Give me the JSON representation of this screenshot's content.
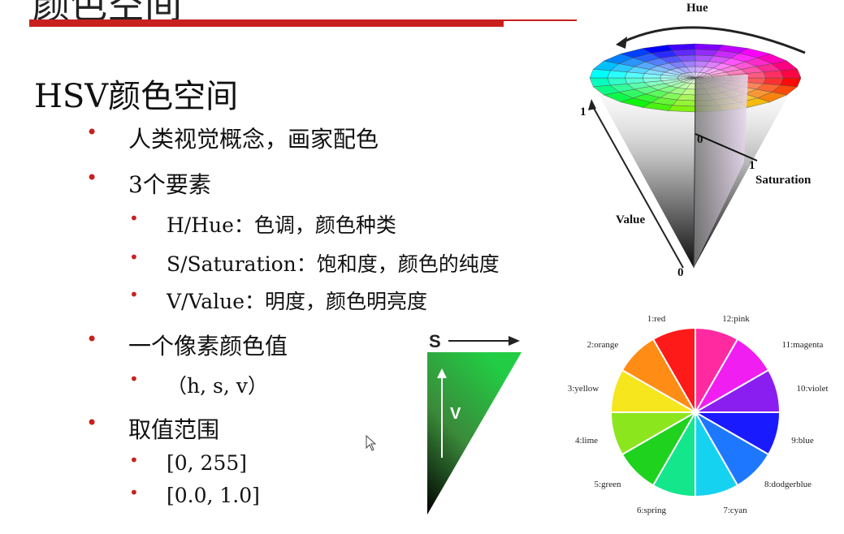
{
  "slide": {
    "title": "颜色空间",
    "heading": "HSV颜色空间"
  },
  "bullets": [
    {
      "level": 1,
      "text": "人类视觉概念，画家配色"
    },
    {
      "level": 1,
      "text": "3个要素"
    },
    {
      "level": 2,
      "text": "H/Hue：色调，颜色种类"
    },
    {
      "level": 2,
      "text": "S/Saturation：饱和度，颜色的纯度"
    },
    {
      "level": 2,
      "text": "V/Value：明度，颜色明亮度"
    },
    {
      "level": 1,
      "text": "一个像素颜色值"
    },
    {
      "level": 2,
      "text": "（h, s, v）"
    },
    {
      "level": 1,
      "text": "取值范围"
    },
    {
      "level": 2,
      "text": "[0,   255]"
    },
    {
      "level": 2,
      "text": "[0.0,  1.0]"
    }
  ],
  "cone_figure": {
    "hue_label": "Hue",
    "value_label": "Value",
    "saturation_label": "Saturation",
    "value_max": "1",
    "value_min": "0",
    "sat_zero": "0",
    "sat_one": "1"
  },
  "sv_triangle": {
    "s_label": "S",
    "v_label": "V"
  },
  "color_wheel": {
    "segments": [
      {
        "label": "1:red",
        "color": "#ff1a1a"
      },
      {
        "label": "12:pink",
        "color": "#ff2aa0"
      },
      {
        "label": "11:magenta",
        "color": "#f01ef0"
      },
      {
        "label": "10:violet",
        "color": "#8a1ef0"
      },
      {
        "label": "9:blue",
        "color": "#1a1aff"
      },
      {
        "label": "8:dodgerblue",
        "color": "#1e78ff"
      },
      {
        "label": "7:cyan",
        "color": "#14d2f0"
      },
      {
        "label": "6:spring",
        "color": "#14e68c"
      },
      {
        "label": "5:green",
        "color": "#1ed21e"
      },
      {
        "label": "4:lime",
        "color": "#8ce61e"
      },
      {
        "label": "3:yellow",
        "color": "#f5e61e"
      },
      {
        "label": "2:orange",
        "color": "#ff8c14"
      }
    ]
  },
  "colors": {
    "accent_red": "#c8201e"
  }
}
